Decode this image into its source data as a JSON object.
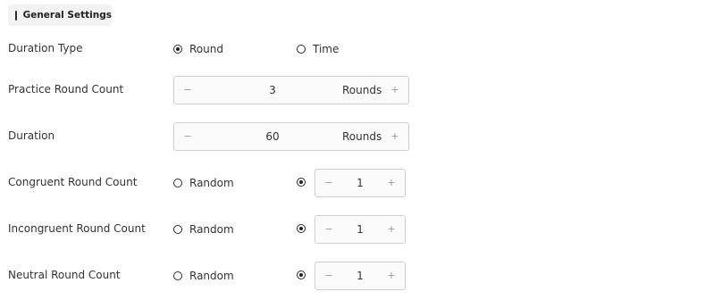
{
  "header": {
    "title": "General Settings",
    "icon": "settings-panel-icon"
  },
  "duration_type": {
    "label": "Duration Type",
    "options": [
      {
        "label": "Round",
        "checked": true
      },
      {
        "label": "Time",
        "checked": false
      }
    ]
  },
  "practice_round_count": {
    "label": "Practice Round Count",
    "value": "3",
    "unit": "Rounds",
    "minus": "−",
    "plus": "+"
  },
  "duration": {
    "label": "Duration",
    "value": "60",
    "unit": "Rounds",
    "minus": "−",
    "plus": "+"
  },
  "congruent_round_count": {
    "label": "Congruent Round Count",
    "random_label": "Random",
    "random_checked": false,
    "fixed_checked": true,
    "value": "1",
    "minus": "−",
    "plus": "+"
  },
  "incongruent_round_count": {
    "label": "Incongruent Round Count",
    "random_label": "Random",
    "random_checked": false,
    "fixed_checked": true,
    "value": "1",
    "minus": "−",
    "plus": "+"
  },
  "neutral_round_count": {
    "label": "Neutral Round Count",
    "random_label": "Random",
    "random_checked": false,
    "fixed_checked": true,
    "value": "1",
    "minus": "−",
    "plus": "+"
  }
}
